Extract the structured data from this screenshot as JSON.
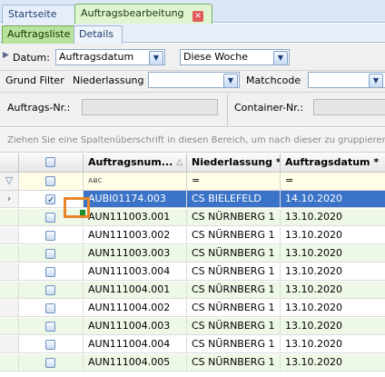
{
  "tabs": [
    {
      "label": "Startseite",
      "active": false
    },
    {
      "label": "Auftragsbearbeitung",
      "active": true
    }
  ],
  "subtabs": [
    {
      "label": "Auftragsliste",
      "active": true
    },
    {
      "label": "Details",
      "active": false
    }
  ],
  "filter": {
    "datum_label": "Datum:",
    "datum_type": "Auftragsdatum",
    "datum_range": "Diese Woche",
    "grund_filter_label": "Grund Filter",
    "niederlassung_label": "Niederlassung",
    "niederlassung_value": "",
    "matchcode_label": "Matchcode",
    "matchcode_value": "",
    "auftrags_nr_label": "Auftrags-Nr.:",
    "container_nr_label": "Container-Nr.:"
  },
  "group_hint": "Ziehen Sie eine Spaltenüberschrift in diesen Bereich, um nach dieser zu gruppieren",
  "grid": {
    "columns": [
      "Auftragsnum...",
      "Niederlassung *",
      "Auftragsdatum *"
    ],
    "filter_row": {
      "auftragsnr_op": "ᴀᴃc",
      "niederlassung_op": "=",
      "datum_op": "="
    },
    "rows": [
      {
        "nr": "AUBI01174.003",
        "niederlassung": "CS BIELEFELD",
        "datum": "14.10.2020",
        "selected": true
      },
      {
        "nr": "AUN111003.001",
        "niederlassung": "CS NÜRNBERG 1",
        "datum": "13.10.2020"
      },
      {
        "nr": "AUN111003.002",
        "niederlassung": "CS NÜRNBERG 1",
        "datum": "13.10.2020"
      },
      {
        "nr": "AUN111003.003",
        "niederlassung": "CS NÜRNBERG 1",
        "datum": "13.10.2020"
      },
      {
        "nr": "AUN111003.004",
        "niederlassung": "CS NÜRNBERG 1",
        "datum": "13.10.2020"
      },
      {
        "nr": "AUN111004.001",
        "niederlassung": "CS NÜRNBERG 1",
        "datum": "13.10.2020"
      },
      {
        "nr": "AUN111004.002",
        "niederlassung": "CS NÜRNBERG 1",
        "datum": "13.10.2020"
      },
      {
        "nr": "AUN111004.003",
        "niederlassung": "CS NÜRNBERG 1",
        "datum": "13.10.2020"
      },
      {
        "nr": "AUN111004.004",
        "niederlassung": "CS NÜRNBERG 1",
        "datum": "13.10.2020"
      },
      {
        "nr": "AUN111004.005",
        "niederlassung": "CS NÜRNBERG 1",
        "datum": "13.10.2020"
      }
    ]
  },
  "colors": {
    "selection": "#3a73c7",
    "alt_row": "#edf8e6",
    "highlight": "#e8862e",
    "filter_row": "#fffde6"
  }
}
